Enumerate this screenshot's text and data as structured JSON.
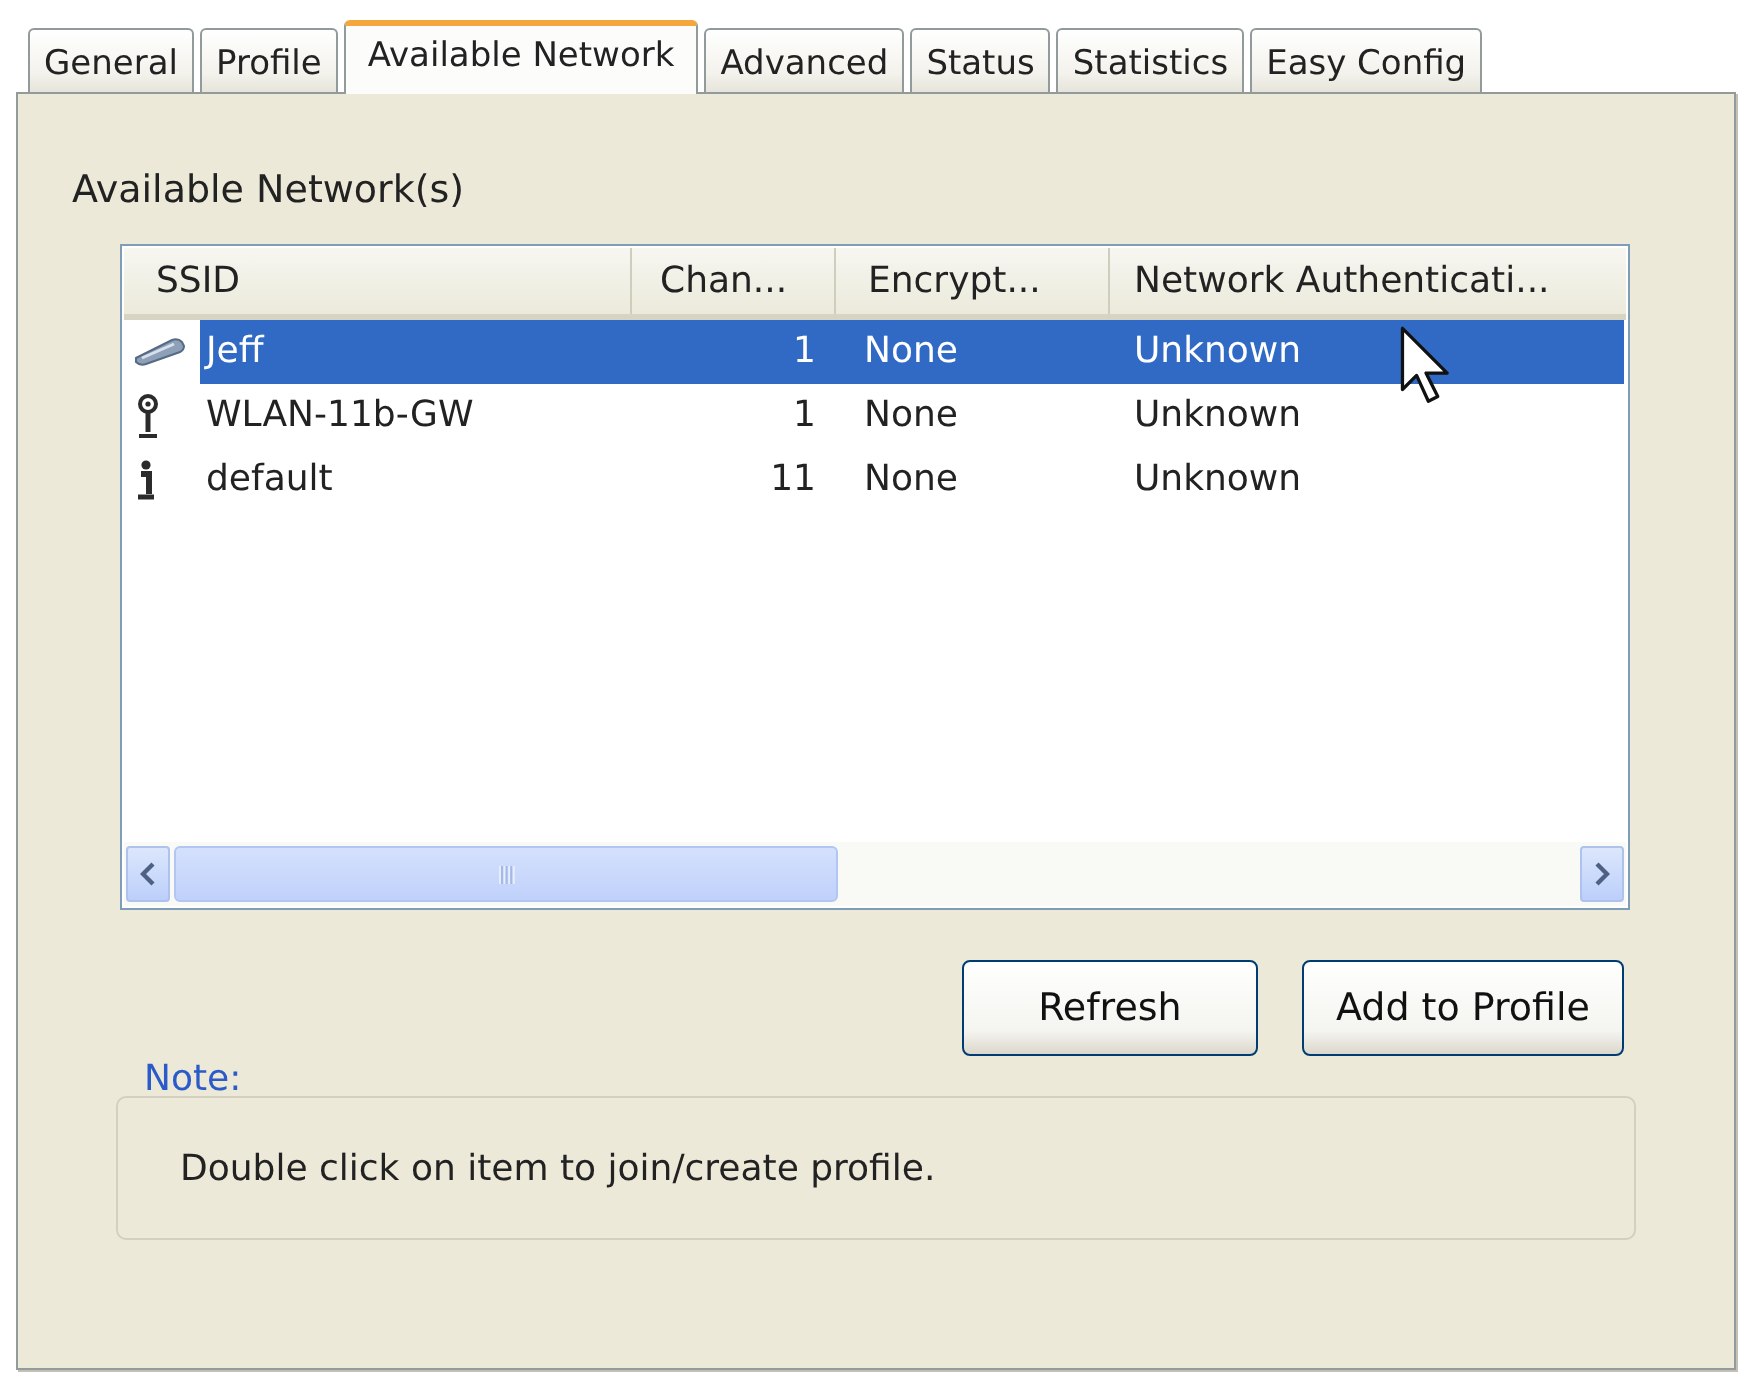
{
  "tabs": [
    {
      "label": "General",
      "selected": false
    },
    {
      "label": "Profile",
      "selected": false
    },
    {
      "label": "Available Network",
      "selected": true
    },
    {
      "label": "Advanced",
      "selected": false
    },
    {
      "label": "Status",
      "selected": false
    },
    {
      "label": "Statistics",
      "selected": false
    },
    {
      "label": "Easy Config",
      "selected": false
    }
  ],
  "available_networks": {
    "title": "Available Network(s)",
    "columns": [
      "SSID",
      "Chan...",
      "Encrypt...",
      "Network Authenticati..."
    ],
    "rows": [
      {
        "kind": "card",
        "ssid": "Jeff",
        "channel": "1",
        "encryption": "None",
        "authentication": "Unknown",
        "selected": true
      },
      {
        "kind": "antenna",
        "ssid": "WLAN-11b-GW",
        "channel": "1",
        "encryption": "None",
        "authentication": "Unknown",
        "selected": false
      },
      {
        "kind": "info",
        "ssid": "default",
        "channel": "11",
        "encryption": "None",
        "authentication": "Unknown",
        "selected": false
      }
    ]
  },
  "buttons": [
    "Refresh",
    "Add to Profile"
  ],
  "note": {
    "label": "Note:",
    "text": "Double click on item to join/create profile."
  }
}
